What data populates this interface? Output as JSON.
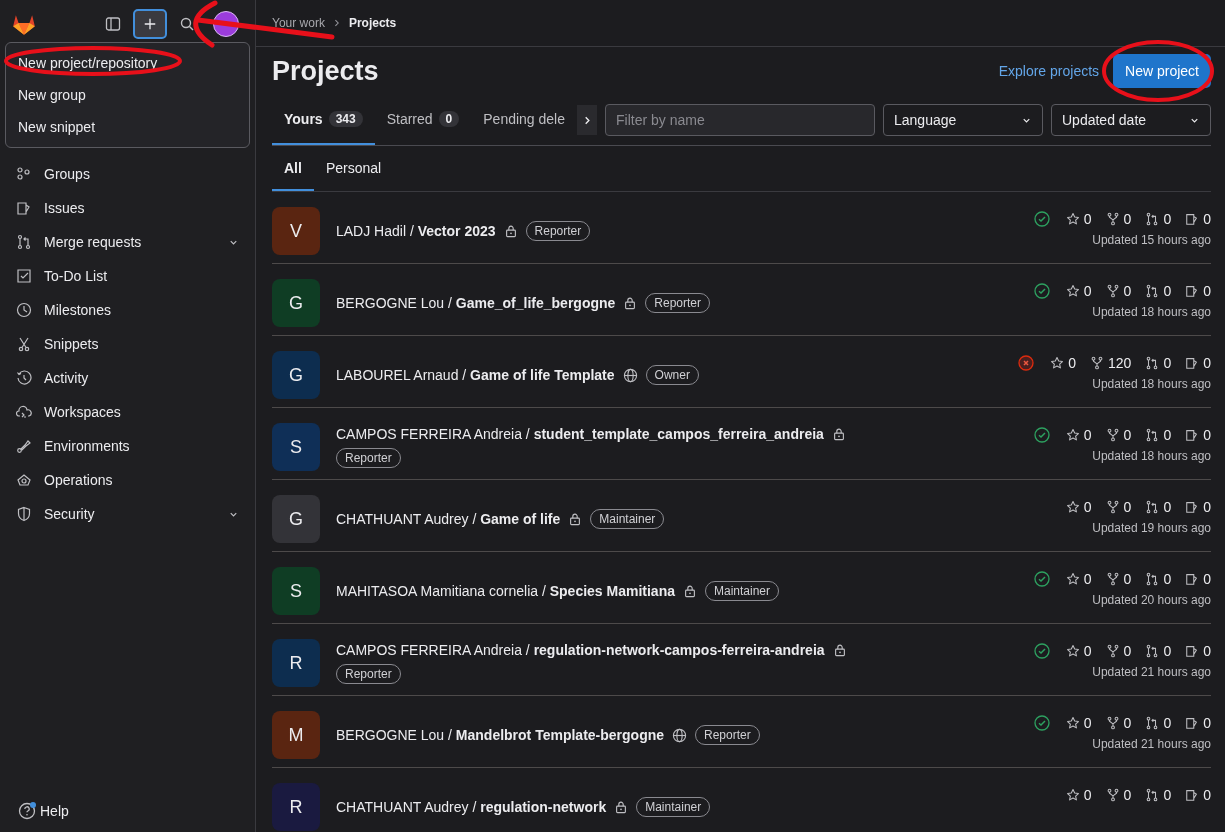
{
  "breadcrumb": [
    "Your work",
    "Projects"
  ],
  "new_menu": {
    "items": [
      {
        "label": "New project/repository"
      },
      {
        "label": "New group"
      },
      {
        "label": "New snippet"
      }
    ]
  },
  "sidebar": {
    "items": [
      {
        "label": "Groups",
        "has_submenu": false
      },
      {
        "label": "Issues",
        "has_submenu": false
      },
      {
        "label": "Merge requests",
        "has_submenu": true
      },
      {
        "label": "To-Do List",
        "has_submenu": false
      },
      {
        "label": "Milestones",
        "has_submenu": false
      },
      {
        "label": "Snippets",
        "has_submenu": false
      },
      {
        "label": "Activity",
        "has_submenu": false
      },
      {
        "label": "Workspaces",
        "has_submenu": false
      },
      {
        "label": "Environments",
        "has_submenu": false
      },
      {
        "label": "Operations",
        "has_submenu": false
      },
      {
        "label": "Security",
        "has_submenu": true
      }
    ],
    "help": "Help"
  },
  "page_title": "Projects",
  "explore_link": "Explore projects",
  "new_project_button": "New project",
  "tabs": [
    {
      "label": "Yours",
      "count": "343",
      "selected": true
    },
    {
      "label": "Starred",
      "count": "0",
      "selected": false
    },
    {
      "label": "Pending dele",
      "selected": false
    }
  ],
  "filter": {
    "placeholder": "Filter by name"
  },
  "language_dropdown": "Language",
  "sort_dropdown": "Updated date",
  "subtabs": [
    {
      "label": "All",
      "selected": true
    },
    {
      "label": "Personal",
      "selected": false
    }
  ],
  "projects": [
    {
      "avatar": "V",
      "color": "#5a2511",
      "title": "LADJ Hadil / **Vector 2023**",
      "private": true,
      "role": "Reporter",
      "pipeline_passed": true,
      "stars": "0",
      "forks": "0",
      "merge_requests": "0",
      "issues": "0",
      "updated": "Updated 15 hours ago"
    },
    {
      "avatar": "G",
      "color": "#0f3d24",
      "title": "BERGOGNE Lou / **Game_of_life_bergogne**",
      "private": true,
      "role": "Reporter",
      "pipeline_passed": true,
      "stars": "0",
      "forks": "0",
      "merge_requests": "0",
      "issues": "0",
      "updated": "Updated 18 hours ago"
    },
    {
      "avatar": "G",
      "color": "#0d2d4f",
      "title": "LABOUREL Arnaud / **Game of life Template**",
      "private": false,
      "role": "Owner",
      "pipeline_passed": false,
      "stars": "0",
      "forks": "120",
      "merge_requests": "0",
      "issues": "0",
      "updated": "Updated 18 hours ago"
    },
    {
      "avatar": "S",
      "color": "#0f2f57",
      "title": "CAMPOS FERREIRA Andreia / **student_template_campos_ferreira_andreia**",
      "private": true,
      "role": "Reporter",
      "pipeline_passed": true,
      "stars": "0",
      "forks": "0",
      "merge_requests": "0",
      "issues": "0",
      "updated": "Updated 18 hours ago"
    },
    {
      "avatar": "G",
      "color": "#333338",
      "title": "CHATHUANT Audrey / **Game of life**",
      "private": true,
      "role": "Maintainer",
      "stars": "0",
      "forks": "0",
      "merge_requests": "0",
      "issues": "0",
      "updated": "Updated 19 hours ago"
    },
    {
      "avatar": "S",
      "color": "#0f3d24",
      "title": "MAHITASOA Mamitiana cornelia / **Species Mamitiana**",
      "private": true,
      "role": "Maintainer",
      "pipeline_passed": true,
      "stars": "0",
      "forks": "0",
      "merge_requests": "0",
      "issues": "0",
      "updated": "Updated 20 hours ago"
    },
    {
      "avatar": "R",
      "color": "#0d2d4f",
      "title": "CAMPOS FERREIRA Andreia / **regulation-network-campos-ferreira-andreia**",
      "private": true,
      "role": "Reporter",
      "pipeline_passed": true,
      "stars": "0",
      "forks": "0",
      "merge_requests": "0",
      "issues": "0",
      "updated": "Updated 21 hours ago"
    },
    {
      "avatar": "M",
      "color": "#5a2511",
      "title": "BERGOGNE Lou / **Mandelbrot Template-bergogne**",
      "private": false,
      "role": "Reporter",
      "pipeline_passed": true,
      "stars": "0",
      "forks": "0",
      "merge_requests": "0",
      "issues": "0",
      "updated": "Updated 21 hours ago"
    },
    {
      "avatar": "R",
      "color": "#1a1a40",
      "title": "CHATHUANT Audrey / **regulation-network**",
      "private": true,
      "role": "Maintainer",
      "stars": "0",
      "forks": "0",
      "merge_requests": "0",
      "issues": "0"
    }
  ]
}
